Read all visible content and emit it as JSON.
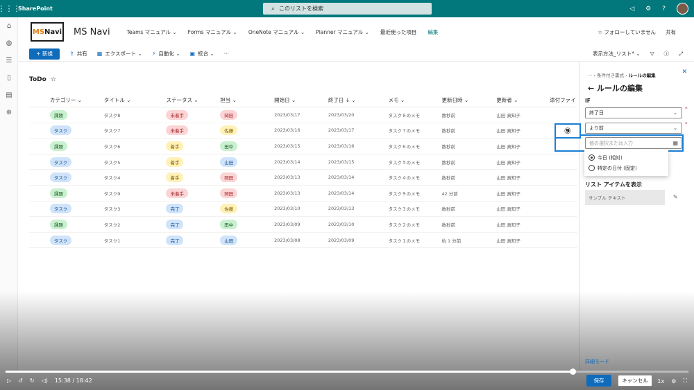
{
  "topbar": {
    "app_name": "SharePoint",
    "search_placeholder": "このリストを検索"
  },
  "site": {
    "logo_text_prefix": "MS",
    "logo_text_suffix": "Navi",
    "name": "MS Navi",
    "nav": [
      {
        "label": "Teams マニュアル ⌄"
      },
      {
        "label": "Forms マニュアル ⌄"
      },
      {
        "label": "OneNote マニュアル ⌄"
      },
      {
        "label": "Planner マニュアル ⌄"
      },
      {
        "label": "最近使った項目"
      },
      {
        "label": "編集"
      }
    ],
    "follow": "☆ フォローしていません",
    "share": "共有"
  },
  "commands": {
    "new": "+ 新規",
    "share": "共有",
    "export": "エクスポート ⌄",
    "automate": "自動化 ⌄",
    "integrate": "統合 ⌄",
    "more": "···",
    "view": "表示方法_リスト* ⌄"
  },
  "list": {
    "title": "ToDo",
    "headers": [
      "カテゴリー ⌄",
      "タイトル ⌄",
      "ステータス ⌄",
      "担当 ⌄",
      "開始日 ⌄",
      "終了日 ↓ ⌄",
      "メモ ⌄",
      "更新日時 ⌄",
      "更新者 ⌄",
      "添付ファイ"
    ],
    "rows": [
      {
        "cat": "課題",
        "cat_c": "green",
        "title": "タスク8",
        "status": "未着手",
        "status_c": "red",
        "owner": "岡田",
        "owner_c": "red",
        "start": "2023/03/17",
        "end": "2023/03/20",
        "memo": "タスク８のメモ",
        "modified": "数秒前",
        "by": "山田 真知子"
      },
      {
        "cat": "タスク",
        "cat_c": "blue",
        "title": "タスク7",
        "status": "未着手",
        "status_c": "red",
        "owner": "佐藤",
        "owner_c": "yellow",
        "start": "2023/03/16",
        "end": "2023/03/17",
        "memo": "タスク７のメモ",
        "modified": "数秒前",
        "by": "山田 真知子"
      },
      {
        "cat": "課題",
        "cat_c": "green",
        "title": "タスク6",
        "status": "着手",
        "status_c": "yellow",
        "owner": "田中",
        "owner_c": "green",
        "start": "2023/03/15",
        "end": "2023/03/16",
        "memo": "タスク６のメモ",
        "modified": "数秒前",
        "by": "山田 真知子"
      },
      {
        "cat": "タスク",
        "cat_c": "blue",
        "title": "タスク5",
        "status": "着手",
        "status_c": "yellow",
        "owner": "山田",
        "owner_c": "blue",
        "start": "2023/03/14",
        "end": "2023/03/15",
        "memo": "タスク５のメモ",
        "modified": "数秒前",
        "by": "山田 真知子"
      },
      {
        "cat": "タスク",
        "cat_c": "blue",
        "title": "タスク4",
        "status": "着手",
        "status_c": "yellow",
        "owner": "岡田",
        "owner_c": "red",
        "start": "2023/03/13",
        "end": "2023/03/14",
        "memo": "タスク４のメモ",
        "modified": "数秒前",
        "by": "山田 真知子"
      },
      {
        "cat": "課題",
        "cat_c": "green",
        "title": "タスク9",
        "status": "未着手",
        "status_c": "red",
        "owner": "岡田",
        "owner_c": "red",
        "start": "2023/03/13",
        "end": "2023/03/14",
        "memo": "タスク９のメモ",
        "modified": "42 分前",
        "by": "山田 真知子"
      },
      {
        "cat": "タスク",
        "cat_c": "blue",
        "title": "タスク3",
        "status": "完了",
        "status_c": "blue",
        "owner": "佐藤",
        "owner_c": "yellow",
        "start": "2023/03/10",
        "end": "2023/03/13",
        "memo": "タスク３のメモ",
        "modified": "数秒前",
        "by": "山田 真知子"
      },
      {
        "cat": "課題",
        "cat_c": "green",
        "title": "タスク2",
        "status": "完了",
        "status_c": "blue",
        "owner": "田中",
        "owner_c": "green",
        "start": "2023/03/09",
        "end": "2023/03/10",
        "memo": "タスク２のメモ",
        "modified": "数秒前",
        "by": "山田 真知子"
      },
      {
        "cat": "タスク",
        "cat_c": "blue",
        "title": "タスク1",
        "status": "完了",
        "status_c": "blue",
        "owner": "山田",
        "owner_c": "blue",
        "start": "2023/03/08",
        "end": "2023/03/09",
        "memo": "タスク１のメモ",
        "modified": "約 1 分前",
        "by": "山田 真知子"
      }
    ]
  },
  "panel": {
    "breadcrumb_dots": "···",
    "breadcrumb_mid": "条件付き書式",
    "breadcrumb_current": "ルールの編集",
    "title": "ルールの編集",
    "if_label": "IF",
    "field1": "終了日",
    "field2": "より前",
    "date_placeholder": "値の選択または入力",
    "step_badge": "⑨",
    "opt1": "今日 (相対)",
    "opt2": "特定の日付 (固定)",
    "show_label": "リスト アイテムを表示",
    "sample_text": "サンプル テキスト",
    "advanced": "詳細モード",
    "save": "保存",
    "cancel": "キャンセル"
  },
  "video": {
    "time": "15:38 / 18:42",
    "speed": "1x"
  }
}
